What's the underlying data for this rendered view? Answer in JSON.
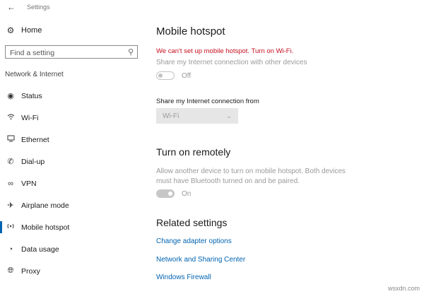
{
  "window": {
    "back_icon": "back-arrow-icon",
    "title": "Settings"
  },
  "sidebar": {
    "home": {
      "icon": "gear-icon",
      "label": "Home"
    },
    "search": {
      "placeholder": "Find a setting",
      "icon": "search-icon"
    },
    "section_label": "Network & Internet",
    "items": [
      {
        "icon": "status-icon",
        "label": "Status",
        "active": false
      },
      {
        "icon": "wifi-icon",
        "label": "Wi-Fi",
        "active": false
      },
      {
        "icon": "ethernet-icon",
        "label": "Ethernet",
        "active": false
      },
      {
        "icon": "dialup-icon",
        "label": "Dial-up",
        "active": false
      },
      {
        "icon": "vpn-icon",
        "label": "VPN",
        "active": false
      },
      {
        "icon": "airplane-icon",
        "label": "Airplane mode",
        "active": false
      },
      {
        "icon": "hotspot-icon",
        "label": "Mobile hotspot",
        "active": true
      },
      {
        "icon": "data-usage-icon",
        "label": "Data usage",
        "active": false
      },
      {
        "icon": "proxy-icon",
        "label": "Proxy",
        "active": false
      }
    ]
  },
  "main": {
    "title": "Mobile hotspot",
    "error": "We can't set up mobile hotspot. Turn on Wi-Fi.",
    "share_desc": "Share my Internet connection with other devices",
    "share_toggle": {
      "state": "Off",
      "on": false
    },
    "share_from_label": "Share my Internet connection from",
    "share_from_value": "Wi-Fi",
    "remote_title": "Turn on remotely",
    "remote_desc": "Allow another device to turn on mobile hotspot. Both devices must have Bluetooth turned on and be paired.",
    "remote_toggle": {
      "state": "On",
      "on": true
    },
    "related_title": "Related settings",
    "links": [
      "Change adapter options",
      "Network and Sharing Center",
      "Windows Firewall"
    ]
  },
  "watermark": "wsxdn.com",
  "colors": {
    "accent": "#0063b1",
    "error": "#c50f1f",
    "disabled_text": "#9a9a9a"
  }
}
